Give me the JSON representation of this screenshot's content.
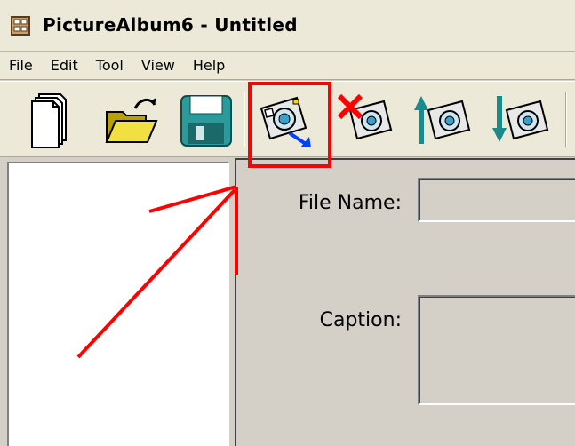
{
  "window": {
    "title": "PictureAlbum6 - Untitled"
  },
  "menu": {
    "items": [
      "File",
      "Edit",
      "Tool",
      "View",
      "Help"
    ]
  },
  "toolbar": {
    "buttons": [
      {
        "icon": "new-document-icon"
      },
      {
        "icon": "open-folder-icon"
      },
      {
        "icon": "save-floppy-icon"
      },
      {
        "icon": "camera-add-icon",
        "highlighted": true
      },
      {
        "icon": "camera-delete-icon"
      },
      {
        "icon": "camera-move-up-icon"
      },
      {
        "icon": "camera-move-down-icon"
      }
    ]
  },
  "form": {
    "file_name_label": "File Name:",
    "file_name_value": "",
    "caption_label": "Caption:",
    "caption_value": ""
  },
  "annotation": {
    "color": "#ff0000"
  }
}
